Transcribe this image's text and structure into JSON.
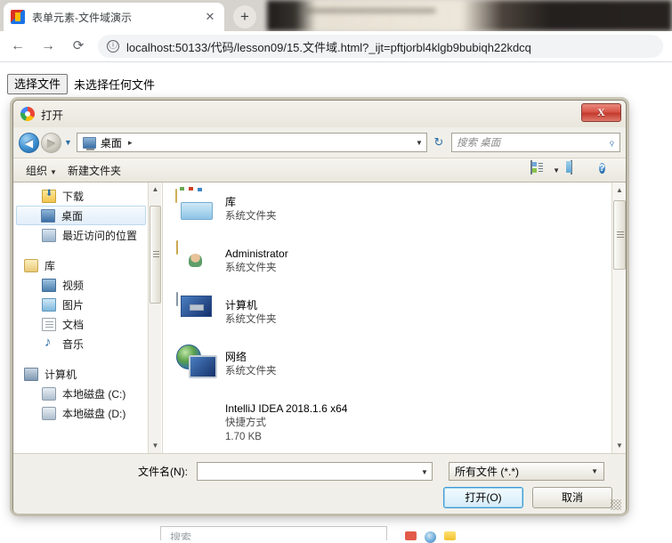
{
  "browser": {
    "tab": {
      "title": "表单元素-文件域演示",
      "close_label": "✕",
      "favicon": "page-favicon"
    },
    "newtab_label": "+",
    "nav": {
      "back": "←",
      "forward": "→",
      "reload": "⟳"
    },
    "omnibox": {
      "info_icon": "ⓘ",
      "url": "localhost:50133/代码/lesson09/15.文件域.html?_ijt=pftjorbl4klgb9bubiqh22kdcq"
    }
  },
  "page": {
    "file_input": {
      "button_label": "选择文件",
      "status": "未选择任何文件"
    }
  },
  "taskbar": {
    "search_placeholder": "搜索"
  },
  "dialog": {
    "title": "打开",
    "close_label": "X",
    "nav": {
      "back": "◀",
      "forward": "▶",
      "history_caret": "▼"
    },
    "breadcrumb": {
      "location": "桌面",
      "separator": "▸",
      "caret": "▼"
    },
    "refresh_label": "↻",
    "search": {
      "placeholder": "搜索 桌面",
      "icon": "⌕"
    },
    "toolbar": {
      "organize": "组织",
      "organize_caret": "▼",
      "new_folder": "新建文件夹",
      "view_caret": "▼",
      "help_label": "?"
    },
    "sidebar": [
      {
        "label": "下载",
        "icon": "downloads-icon",
        "type": "child",
        "selected": false
      },
      {
        "label": "桌面",
        "icon": "desktop-icon",
        "type": "child",
        "selected": true
      },
      {
        "label": "最近访问的位置",
        "icon": "recent-places-icon",
        "type": "child",
        "selected": false
      },
      {
        "label": "库",
        "icon": "library-icon",
        "type": "group",
        "selected": false
      },
      {
        "label": "视频",
        "icon": "videos-icon",
        "type": "child",
        "selected": false
      },
      {
        "label": "图片",
        "icon": "pictures-icon",
        "type": "child",
        "selected": false
      },
      {
        "label": "文档",
        "icon": "documents-icon",
        "type": "child",
        "selected": false
      },
      {
        "label": "音乐",
        "icon": "music-icon",
        "type": "child",
        "selected": false
      },
      {
        "label": "计算机",
        "icon": "computer-icon",
        "type": "group",
        "selected": false
      },
      {
        "label": "本地磁盘 (C:)",
        "icon": "disk-icon",
        "type": "child",
        "selected": false
      },
      {
        "label": "本地磁盘 (D:)",
        "icon": "disk-icon",
        "type": "child",
        "selected": false
      }
    ],
    "files": [
      {
        "name": "库",
        "meta1": "系统文件夹",
        "meta2": "",
        "icon": "library-folder-icon"
      },
      {
        "name": "Administrator",
        "meta1": "系统文件夹",
        "meta2": "",
        "icon": "user-folder-icon"
      },
      {
        "name": "计算机",
        "meta1": "系统文件夹",
        "meta2": "",
        "icon": "computer-icon"
      },
      {
        "name": "网络",
        "meta1": "系统文件夹",
        "meta2": "",
        "icon": "network-icon"
      },
      {
        "name": "IntelliJ IDEA 2018.1.6 x64",
        "meta1": "快捷方式",
        "meta2": "1.70 KB",
        "icon": "intellij-idea-icon"
      }
    ],
    "footer": {
      "filename_label": "文件名(N):",
      "filename_value": "",
      "filename_caret": "▼",
      "filetype_value": "所有文件 (*.*)",
      "filetype_caret": "▼",
      "open_button": "打开(O)",
      "cancel_button": "取消"
    }
  },
  "colors": {
    "accent_blue": "#2a6ea8",
    "dialog_bg": "#f0efe9",
    "close_red": "#c33a2c",
    "selection_blue": "#e2eefa"
  }
}
